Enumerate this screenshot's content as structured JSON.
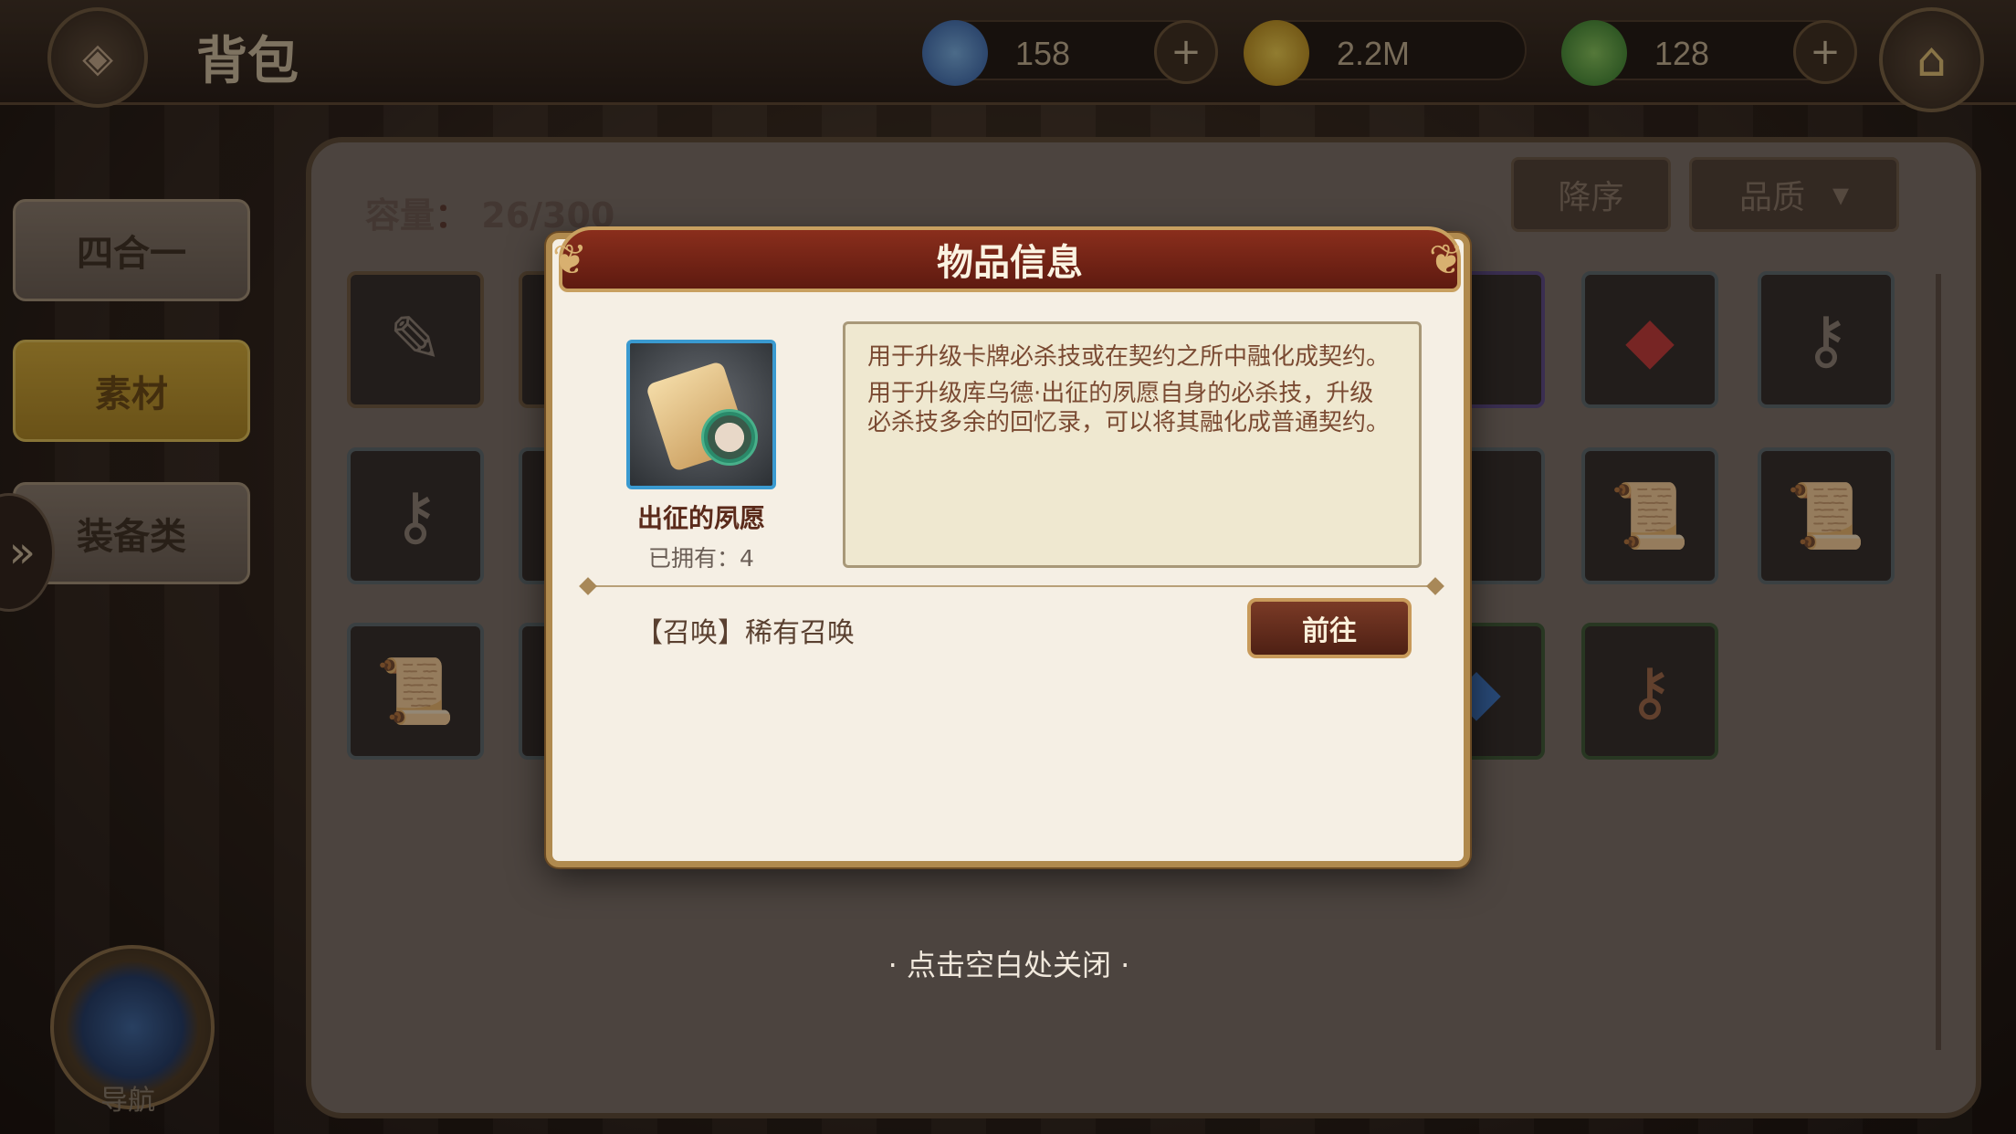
{
  "topbar": {
    "title": "背包",
    "currencies": [
      {
        "name": "diamond",
        "value": "158",
        "color": "#3a7ad0"
      },
      {
        "name": "gold",
        "value": "2.2M",
        "color": "#e0b020"
      },
      {
        "name": "leaf",
        "value": "128",
        "color": "#4aa03a"
      }
    ]
  },
  "sidebar": {
    "tabs": [
      {
        "label": "四合一"
      },
      {
        "label": "素材"
      },
      {
        "label": "装备类"
      }
    ],
    "compass_label": "导航"
  },
  "bag": {
    "capacity_label": "容量",
    "capacity_value": "26/300",
    "sort_label": "降序",
    "filter_label": "品质"
  },
  "modal": {
    "title": "物品信息",
    "item_name": "出征的夙愿",
    "owned_text": "已拥有：4",
    "description": [
      "用于升级卡牌必杀技或在契约之所中融化成契约。",
      "用于升级库乌德·出征的夙愿自身的必杀技，升级必杀技多余的回忆录，可以将其融化成普通契约。"
    ],
    "source_label": "【召唤】稀有召唤",
    "go_button": "前往"
  },
  "close_hint": "· 点击空白处关闭 ·"
}
